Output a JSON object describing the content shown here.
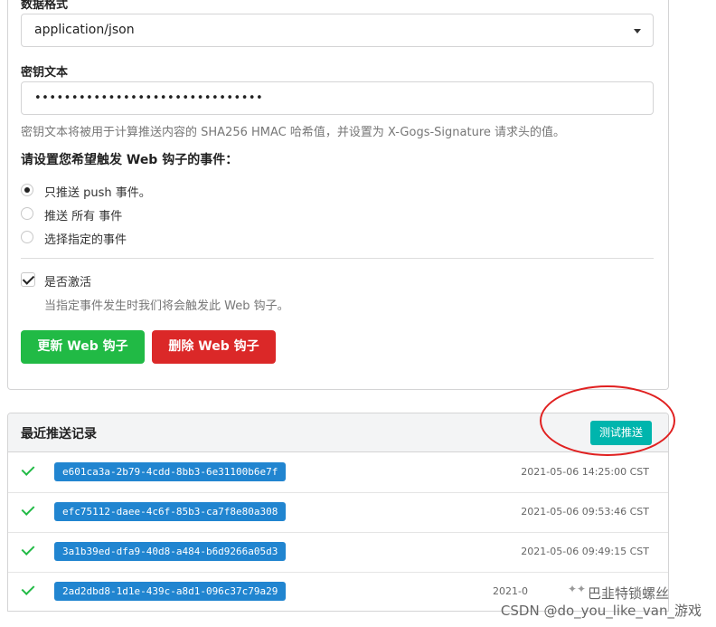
{
  "settings": {
    "content_type_label": "数据格式",
    "content_type_value": "application/json",
    "secret_label": "密钥文本",
    "secret_value": "•••••••••••••••••••••••••••••••",
    "secret_help": "密钥文本将被用于计算推送内容的 SHA256 HMAC 哈希值，并设置为 X-Gogs-Signature 请求头的值。",
    "events_heading": "请设置您希望触发 Web 钩子的事件：",
    "events": [
      {
        "label": "只推送 push 事件。",
        "checked": true
      },
      {
        "label": "推送 所有 事件",
        "checked": false
      },
      {
        "label": "选择指定的事件",
        "checked": false
      }
    ],
    "active_label": "是否激活",
    "active_checked": true,
    "active_help": "当指定事件发生时我们将会触发此 Web 钩子。",
    "update_button": "更新 Web 钩子",
    "delete_button": "删除 Web 钩子"
  },
  "deliveries": {
    "title": "最近推送记录",
    "test_button": "测试推送",
    "rows": [
      {
        "id": "e601ca3a-2b79-4cdd-8bb3-6e31100b6e7f",
        "time": "2021-05-06 14:25:00 CST",
        "status": "success"
      },
      {
        "id": "efc75112-daee-4c6f-85b3-ca7f8e80a308",
        "time": "2021-05-06 09:53:46 CST",
        "status": "success"
      },
      {
        "id": "3a1b39ed-dfa9-40d8-a484-b6d9266a05d3",
        "time": "2021-05-06 09:49:15 CST",
        "status": "success"
      },
      {
        "id": "2ad2dbd8-1d1e-439c-a8d1-096c37c79a29",
        "time": "2021-0",
        "status": "success"
      }
    ]
  },
  "watermark": {
    "brand": "巴韭特锁螺丝",
    "text": "CSDN @do_you_like_van_游戏"
  },
  "colors": {
    "success": "#21ba45",
    "danger": "#db2828",
    "teal": "#00b5ad",
    "blue": "#2185d0",
    "annotation": "#e02020"
  }
}
